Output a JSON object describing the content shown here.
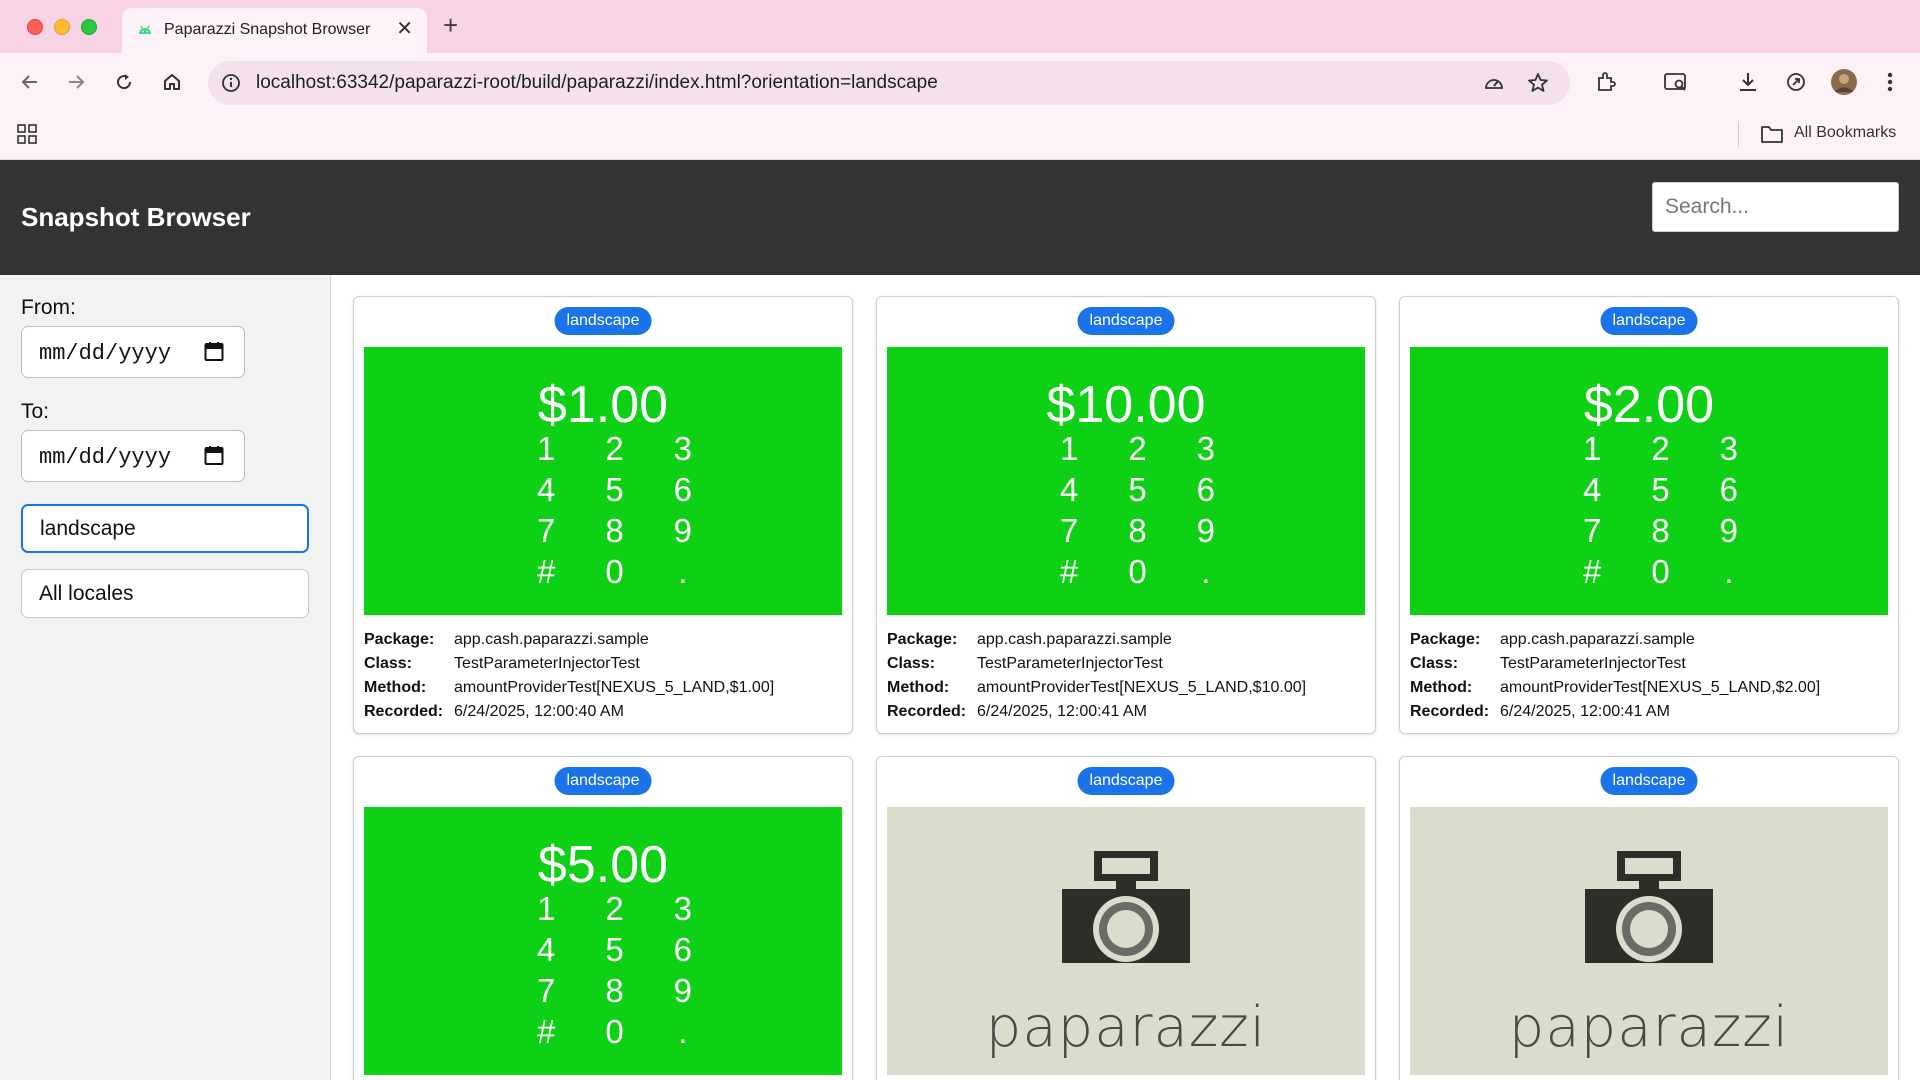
{
  "browser": {
    "tab_title": "Paparazzi Snapshot Browser",
    "url": "localhost:63342/paparazzi-root/build/paparazzi/index.html?orientation=landscape",
    "bookmarks_label": "All Bookmarks"
  },
  "header": {
    "title": "Snapshot Browser",
    "search_placeholder": "Search..."
  },
  "sidebar": {
    "from_label": "From:",
    "from_value": "mm/dd/yyyy",
    "to_label": "To:",
    "to_value": "mm/dd/yyyy",
    "filter_value": "landscape",
    "locale_value": "All locales"
  },
  "meta_labels": {
    "package": "Package:",
    "class": "Class:",
    "method": "Method:",
    "recorded": "Recorded:"
  },
  "keypad_keys": [
    "1",
    "2",
    "3",
    "4",
    "5",
    "6",
    "7",
    "8",
    "9",
    "#",
    "0",
    "."
  ],
  "cards": [
    {
      "badge": "landscape",
      "amount": "$1.00",
      "package": "app.cash.paparazzi.sample",
      "class": "TestParameterInjectorTest",
      "method": "amountProviderTest[NEXUS_5_LAND,$1.00]",
      "recorded": "6/24/2025, 12:00:40 AM"
    },
    {
      "badge": "landscape",
      "amount": "$10.00",
      "package": "app.cash.paparazzi.sample",
      "class": "TestParameterInjectorTest",
      "method": "amountProviderTest[NEXUS_5_LAND,$10.00]",
      "recorded": "6/24/2025, 12:00:41 AM"
    },
    {
      "badge": "landscape",
      "amount": "$2.00",
      "package": "app.cash.paparazzi.sample",
      "class": "TestParameterInjectorTest",
      "method": "amountProviderTest[NEXUS_5_LAND,$2.00]",
      "recorded": "6/24/2025, 12:00:41 AM"
    },
    {
      "badge": "landscape",
      "amount": "$5.00"
    },
    {
      "badge": "landscape",
      "logo_text": "paparazzi"
    },
    {
      "badge": "landscape",
      "logo_text": "paparazzi"
    }
  ],
  "colors": {
    "header_bg": "#333333",
    "badge_bg": "#1a73e8",
    "snapshot_green": "#0ed014",
    "snapshot_gray": "#dcdccd",
    "tab_strip": "#f8d3e6"
  }
}
